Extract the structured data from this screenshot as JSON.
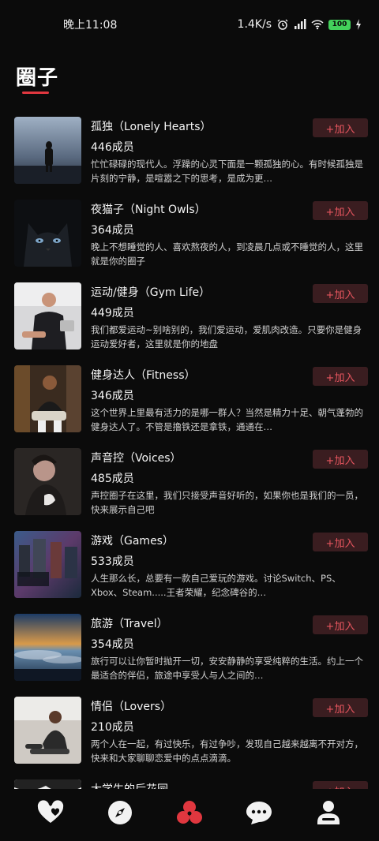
{
  "status_bar": {
    "time": "晚上11:08",
    "network_speed": "1.4K/s",
    "battery": "100"
  },
  "header": {
    "title": "圈子"
  },
  "join_label": "+加入",
  "groups": [
    {
      "name": "孤独（Lonely Hearts）",
      "members": "446成员",
      "description": "忙忙碌碌的现代人。浮躁的心灵下面是一颗孤独的心。有时候孤独是片刻的宁静，是喧嚣之下的思考，是成为更…"
    },
    {
      "name": "夜猫子（Night Owls）",
      "members": "364成员",
      "description": "晚上不想睡觉的人、喜欢熬夜的人，到凌晨几点或不睡觉的人，这里就是你的圈子"
    },
    {
      "name": "运动/健身（Gym Life）",
      "members": "449成员",
      "description": "我们都爱运动~别啥别的，我们爱运动，爱肌肉改造。只要你是健身运动爱好者，这里就是你的地盘"
    },
    {
      "name": "健身达人（Fitness）",
      "members": "346成员",
      "description": "这个世界上里最有活力的是哪一群人？当然是精力十足、朝气蓬勃的健身达人了。不管是撸铁还是拿铁，通通在…"
    },
    {
      "name": "声音控（Voices）",
      "members": "485成员",
      "description": "声控圈子在这里，我们只接受声音好听的，如果你也是我们的一员，快来展示自己吧"
    },
    {
      "name": "游戏（Games）",
      "members": "533成员",
      "description": "人生那么长，总要有一款自己爱玩的游戏。讨论Switch、PS、Xbox、Steam.....王者荣耀，纪念碑谷的…"
    },
    {
      "name": "旅游（Travel）",
      "members": "354成员",
      "description": "旅行可以让你暂时抛开一切，安安静静的享受纯粹的生活。约上一个最适合的伴侣，旅途中享受人与人之间的…"
    },
    {
      "name": "情侣（Lovers）",
      "members": "210成员",
      "description": "两个人在一起，有过快乐，有过争吵，发现自己越来越离不开对方，快来和大家聊聊恋爱中的点点滴滴。"
    },
    {
      "name": "大学生的后花园",
      "members": "",
      "description": ""
    }
  ],
  "tabbar": {
    "items": [
      "heart-icon",
      "compass-icon",
      "circles-icon",
      "chat-icon",
      "profile-icon"
    ],
    "active": "circles-icon",
    "active_color": "#e0373f"
  }
}
